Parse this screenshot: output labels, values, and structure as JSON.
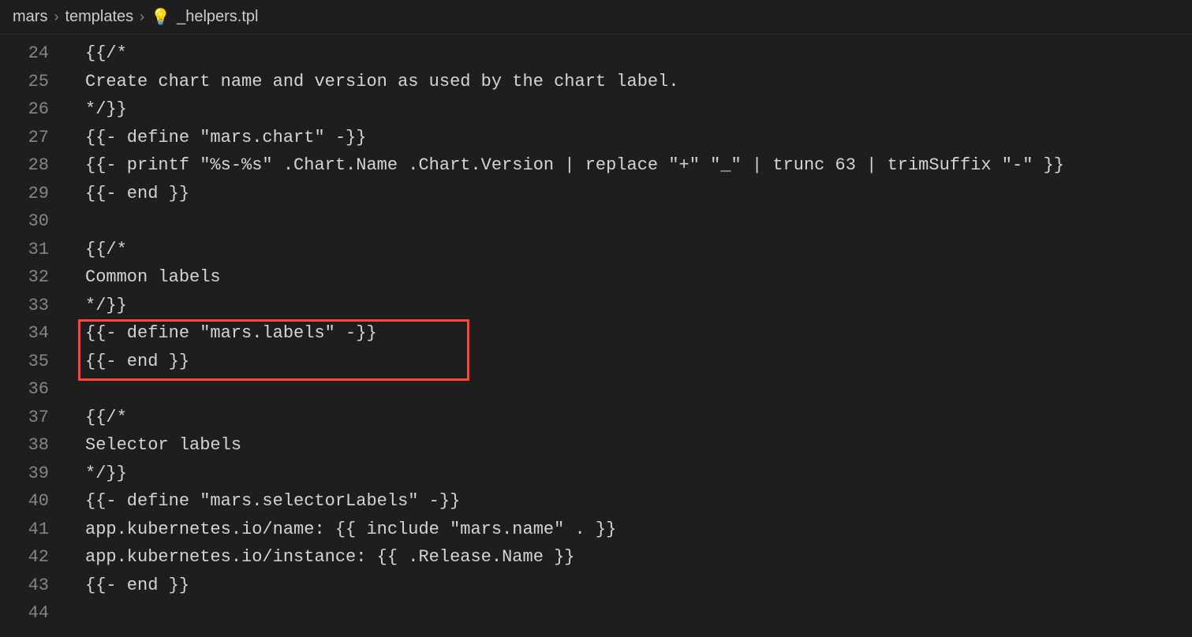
{
  "breadcrumb": {
    "parts": [
      "mars",
      "templates",
      "_helpers.tpl"
    ],
    "icon": "💡"
  },
  "editor": {
    "startLine": 24,
    "lines": [
      "{{/*",
      "Create chart name and version as used by the chart label.",
      "*/}}",
      "{{- define \"mars.chart\" -}}",
      "{{- printf \"%s-%s\" .Chart.Name .Chart.Version | replace \"+\" \"_\" | trunc 63 | trimSuffix \"-\" }}",
      "{{- end }}",
      "",
      "{{/*",
      "Common labels",
      "*/}}",
      "{{- define \"mars.labels\" -}}",
      "{{- end }}",
      "",
      "{{/*",
      "Selector labels",
      "*/}}",
      "{{- define \"mars.selectorLabels\" -}}",
      "app.kubernetes.io/name: {{ include \"mars.name\" . }}",
      "app.kubernetes.io/instance: {{ .Release.Name }}",
      "{{- end }}",
      ""
    ]
  }
}
